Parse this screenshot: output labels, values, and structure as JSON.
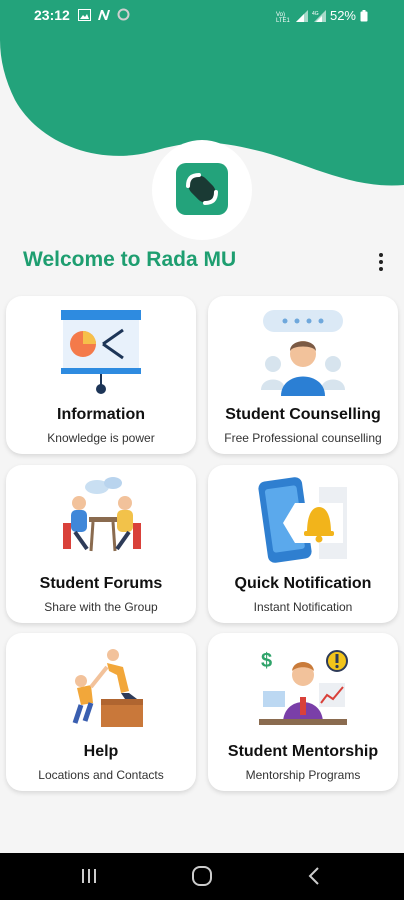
{
  "status_bar": {
    "time": "23:12",
    "battery": "52%",
    "icons": [
      "gallery-icon",
      "n-app-icon",
      "circle-icon",
      "volte-icon",
      "signal-icon",
      "signal-icon",
      "battery-icon"
    ]
  },
  "colors": {
    "brand": "#23a37b",
    "title": "#1e9e70"
  },
  "header": {
    "welcome_text": "Welcome to Rada MU"
  },
  "cards": [
    {
      "title": "Information",
      "subtitle": "Knowledge is power",
      "icon": "presentation-board-icon"
    },
    {
      "title": "Student Counselling",
      "subtitle": "Free Professional counselling",
      "icon": "counsellor-icon"
    },
    {
      "title": "Student Forums",
      "subtitle": "Share with the Group",
      "icon": "group-discussion-icon"
    },
    {
      "title": "Quick Notification",
      "subtitle": "Instant Notification",
      "icon": "phone-bell-icon"
    },
    {
      "title": "Help",
      "subtitle": "Locations and Contacts",
      "icon": "helping-hand-icon"
    },
    {
      "title": "Student Mentorship",
      "subtitle": "Mentorship Programs",
      "icon": "mentor-icon"
    }
  ],
  "nav": {
    "buttons": [
      "recents-icon",
      "home-icon",
      "back-icon"
    ]
  }
}
